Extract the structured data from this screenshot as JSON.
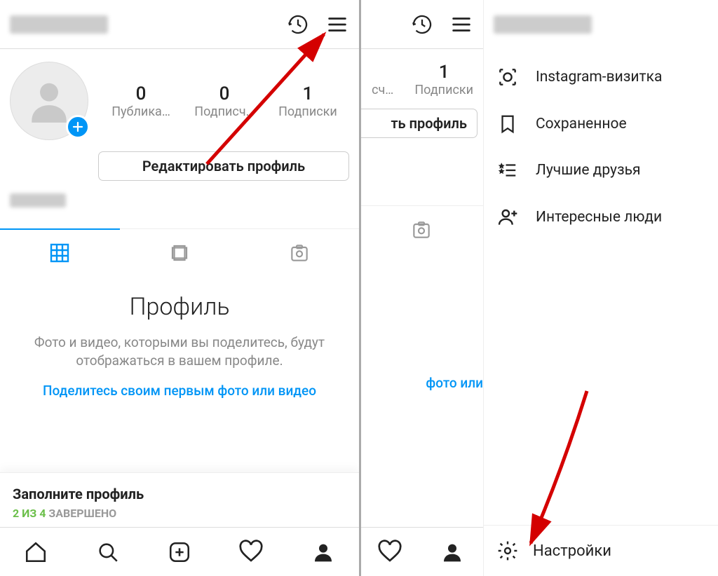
{
  "left": {
    "stats": {
      "posts": {
        "value": "0",
        "label": "Публика…"
      },
      "followers": {
        "value": "0",
        "label": "Подписч…"
      },
      "following": {
        "value": "1",
        "label": "Подписки"
      }
    },
    "edit_button": "Редактировать профиль",
    "empty": {
      "title": "Профиль",
      "desc": "Фото и видео, которыми вы поделитесь, будут отображаться в вашем профиле.",
      "link": "Поделитесь своим первым фото или видео"
    },
    "fill": {
      "title": "Заполните профиль",
      "progress_done": "2 ИЗ 4",
      "progress_rest": " ЗАВЕРШЕНО"
    }
  },
  "right": {
    "underlay": {
      "following": {
        "value": "1",
        "label": "Подписки"
      },
      "followers_label_partial": "сч…",
      "edit_partial": "ть профиль",
      "link_partial": "фото или"
    },
    "menu": {
      "items": [
        {
          "label": "Instagram-визитка",
          "icon": "nametag-icon"
        },
        {
          "label": "Сохраненное",
          "icon": "bookmark-icon"
        },
        {
          "label": "Лучшие друзья",
          "icon": "close-friends-icon"
        },
        {
          "label": "Интересные люди",
          "icon": "discover-people-icon"
        }
      ],
      "footer": "Настройки"
    }
  }
}
